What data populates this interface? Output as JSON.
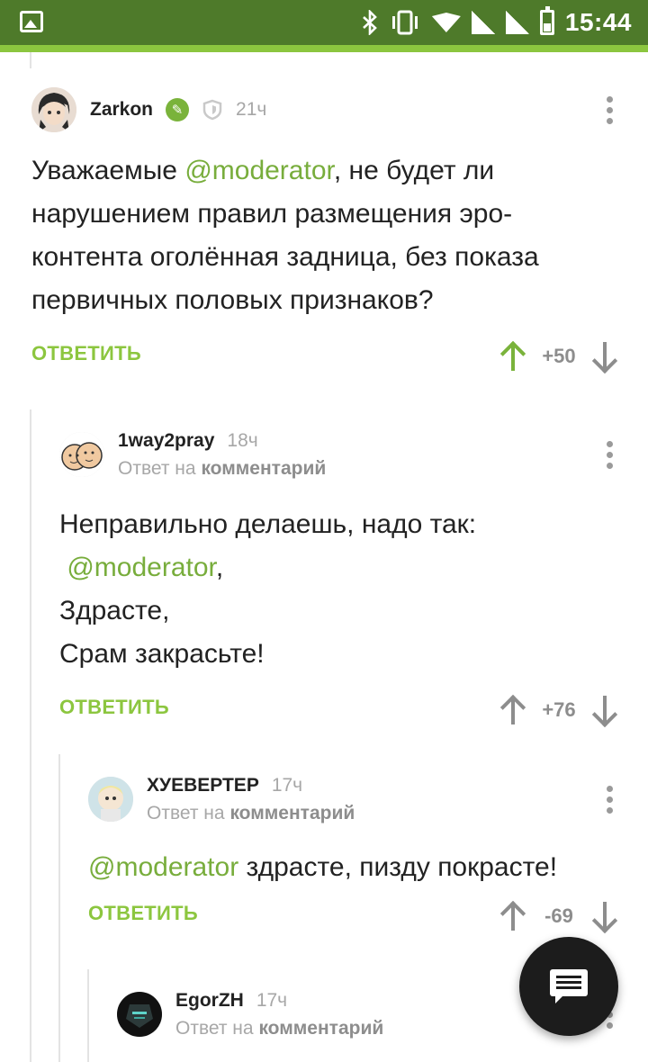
{
  "status_bar": {
    "time": "15:44"
  },
  "comments": [
    {
      "author": "Zarkon",
      "time": "21ч",
      "text_before": "Уважаемые ",
      "mention": "@moderator",
      "text_after": ", не будет ли нарушением правил размещения эро-контента оголённая задница, без показа первичных половых признаков?",
      "reply_label": "ОТВЕТИТЬ",
      "score": "+50",
      "upvoted": true
    },
    {
      "author": "1way2pray",
      "time": "18ч",
      "reply_prefix": "Ответ на",
      "reply_target": "комментарий",
      "line1": "Неправильно делаешь, надо так:",
      "mention": "@moderator",
      "mention_suffix": ",",
      "line3": "Здрасте,",
      "line4": "Срам закрасьте!",
      "reply_label": "ОТВЕТИТЬ",
      "score": "+76"
    },
    {
      "author": "ХУЕВЕРТЕР",
      "time": "17ч",
      "reply_prefix": "Ответ на",
      "reply_target": "комментарий",
      "mention": "@moderator",
      "text_after": " здрасте, пизду покрасте!",
      "reply_label": "ОТВЕТИТЬ",
      "score": "-69"
    },
    {
      "author": "EgorZH",
      "time": "17ч",
      "reply_prefix": "Ответ на",
      "reply_target": "комментарий"
    }
  ],
  "colors": {
    "accent": "#8cc63f",
    "mention": "#78ad3c",
    "status_bar": "#4e7a2a"
  }
}
